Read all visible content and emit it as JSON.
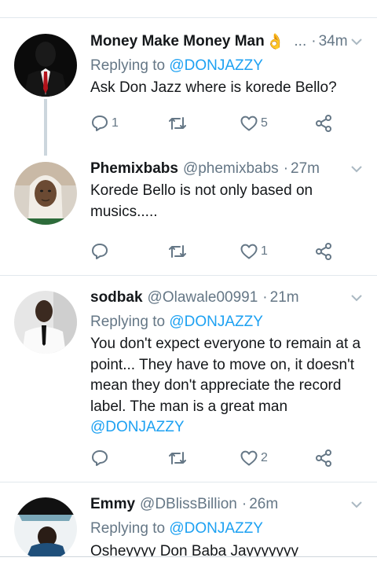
{
  "colors": {
    "accent": "#1da1f2",
    "muted": "#657786",
    "text": "#14171a",
    "divider": "#e1e8ed",
    "thread_line": "#ccd6dd"
  },
  "tweets": [
    {
      "name": "Money Make Money Man",
      "emoji": "👌",
      "truncation": "...",
      "handle": "",
      "time": "34m",
      "replying_prefix": "Replying to",
      "replying_handle": "@DONJAZZY",
      "text": "Ask Don Jazz where is korede Bello?",
      "reply_count": "1",
      "retweet_count": "",
      "like_count": "5"
    },
    {
      "name": "Phemixbabs",
      "handle": "@phemixbabs",
      "time": "27m",
      "text_line1": "Korede Bello is not only based on",
      "text_line2": "musics.....",
      "reply_count": "",
      "retweet_count": "",
      "like_count": "1"
    },
    {
      "name": "sodbak",
      "handle": "@Olawale00991",
      "time": "21m",
      "replying_prefix": "Replying to",
      "replying_handle": "@DONJAZZY",
      "text_lines": [
        "You don't expect everyone to remain at a",
        "point... They have to move on, it doesn't",
        "mean they don't appreciate the record",
        "label. The man is a great man"
      ],
      "text_mention": "@DONJAZZY",
      "reply_count": "",
      "retweet_count": "",
      "like_count": "2"
    },
    {
      "name": "Emmy",
      "handle": "@DBlissBillion",
      "time": "26m",
      "replying_prefix": "Replying to",
      "replying_handle": "@DONJAZZY",
      "text": "Osheyyyy Don Baba Jayyyyyyy"
    }
  ]
}
